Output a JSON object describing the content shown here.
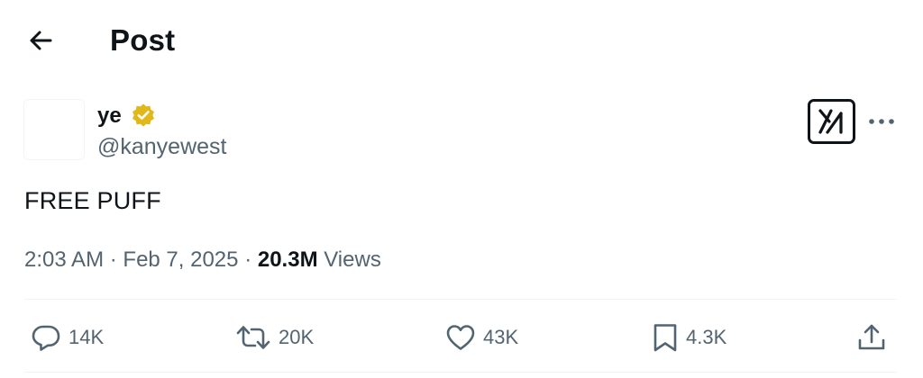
{
  "header": {
    "title": "Post",
    "back_icon": "arrow-left-icon"
  },
  "post": {
    "author": {
      "display_name": "ye",
      "handle": "@kanyewest",
      "verified_badge_color": "#e2b719"
    },
    "text": "FREE PUFF",
    "time": "2:03 AM",
    "separator": "·",
    "date": "Feb 7, 2025",
    "views_count": "20.3M",
    "views_label": "Views"
  },
  "actions": {
    "replies": "14K",
    "reposts": "20K",
    "likes": "43K",
    "bookmarks": "4.3K"
  },
  "colors": {
    "text": "#0f1419",
    "secondary": "#536471",
    "divider": "#eff3f4",
    "badge_gold": "#e2b719"
  }
}
